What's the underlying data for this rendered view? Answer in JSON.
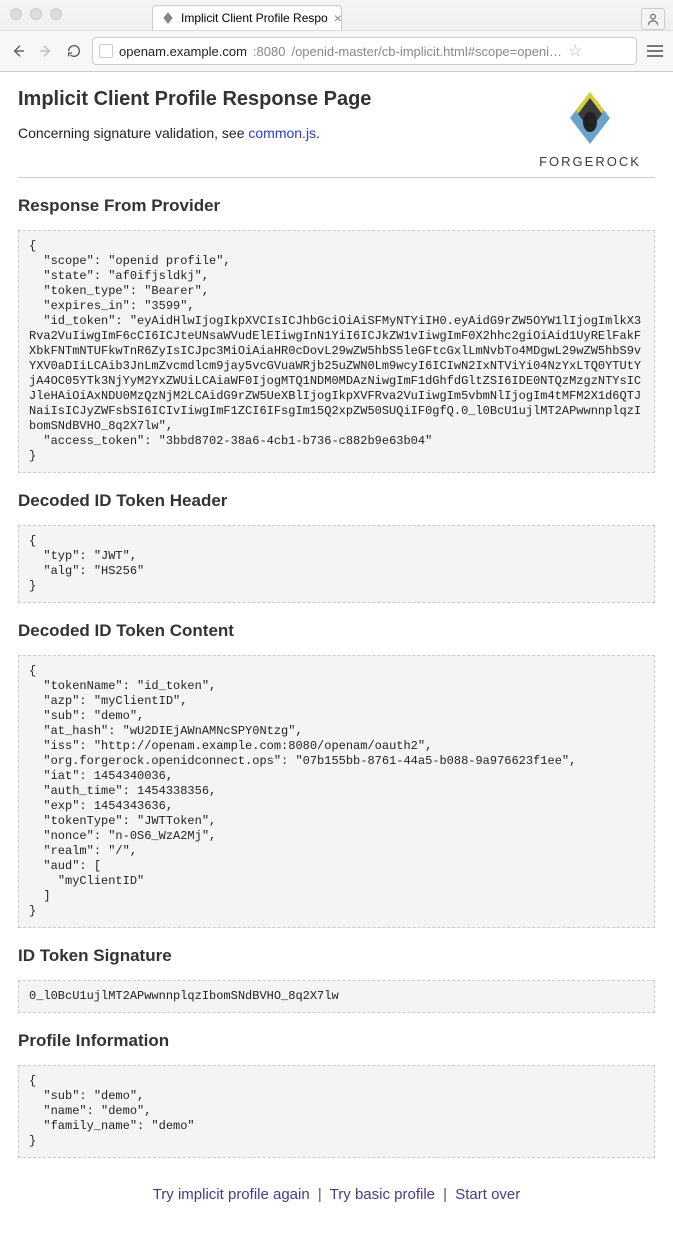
{
  "browser": {
    "tab_title": "Implicit Client Profile Respo",
    "url_domain": "openam.example.com",
    "url_port": ":8080",
    "url_path": "/openid-master/cb-implicit.html#scope=openi…"
  },
  "header": {
    "title": "Implicit Client Profile Response Page",
    "subtitle_prefix": "Concerning signature validation, see ",
    "subtitle_link": "common.js",
    "subtitle_suffix": "."
  },
  "logo": {
    "text": "FORGEROCK"
  },
  "sections": {
    "response_heading": "Response From Provider",
    "response_body": "{\n  \"scope\": \"openid profile\",\n  \"state\": \"af0ifjsldkj\",\n  \"token_type\": \"Bearer\",\n  \"expires_in\": \"3599\",\n  \"id_token\": \"eyAidHlwIjogIkpXVCIsICJhbGciOiAiSFMyNTYiIH0.eyAidG9rZW5OYW1lIjogImlkX3Rva2VuIiwgImF6cCI6ICJteUNsaWVudElEIiwgInN1YiI6ICJkZW1vIiwgImF0X2hhc2giOiAid1UyRElFakFXbkFNTmNTUFkwTnR6ZyIsICJpc3MiOiAiaHR0cDovL29wZW5hbS5leGFtcGxlLmNvbTo4MDgwL29wZW5hbS9vYXV0aDIiLCAib3JnLmZvcmdlcm9jay5vcGVuaWRjb25uZWN0Lm9wcyI6ICIwN2IxNTViYi04NzYxLTQ0YTUtYjA4OC05YTk3NjYyM2YxZWUiLCAiaWF0IjogMTQ1NDM0MDAzNiwgImF1dGhfdGltZSI6IDE0NTQzMzgzNTYsICJleHAiOiAxNDU0MzQzNjM2LCAidG9rZW5UeXBlIjogIkpXVFRva2VuIiwgIm5vbmNlIjogIm4tMFM2X1d6QTJNaiIsICJyZWFsbSI6ICIvIiwgImF1ZCI6IFsgIm15Q2xpZW50SUQiIF0gfQ.0_l0BcU1ujlMT2APwwnnplqzIbomSNdBVHO_8q2X7lw\",\n  \"access_token\": \"3bbd8702-38a6-4cb1-b736-c882b9e63b04\"\n}",
    "header_heading": "Decoded ID Token Header",
    "header_body": "{\n  \"typ\": \"JWT\",\n  \"alg\": \"HS256\"\n}",
    "content_heading": "Decoded ID Token Content",
    "content_body": "{\n  \"tokenName\": \"id_token\",\n  \"azp\": \"myClientID\",\n  \"sub\": \"demo\",\n  \"at_hash\": \"wU2DIEjAWnAMNcSPY0Ntzg\",\n  \"iss\": \"http://openam.example.com:8080/openam/oauth2\",\n  \"org.forgerock.openidconnect.ops\": \"07b155bb-8761-44a5-b088-9a976623f1ee\",\n  \"iat\": 1454340036,\n  \"auth_time\": 1454338356,\n  \"exp\": 1454343636,\n  \"tokenType\": \"JWTToken\",\n  \"nonce\": \"n-0S6_WzA2Mj\",\n  \"realm\": \"/\",\n  \"aud\": [\n    \"myClientID\"\n  ]\n}",
    "signature_heading": "ID Token Signature",
    "signature_body": "0_l0BcU1ujlMT2APwwnnplqzIbomSNdBVHO_8q2X7lw",
    "profile_heading": "Profile Information",
    "profile_body": "{\n  \"sub\": \"demo\",\n  \"name\": \"demo\",\n  \"family_name\": \"demo\"\n}"
  },
  "footer": {
    "link1": "Try implicit profile again",
    "link2": "Try basic profile",
    "link3": "Start over",
    "sep": "|"
  }
}
